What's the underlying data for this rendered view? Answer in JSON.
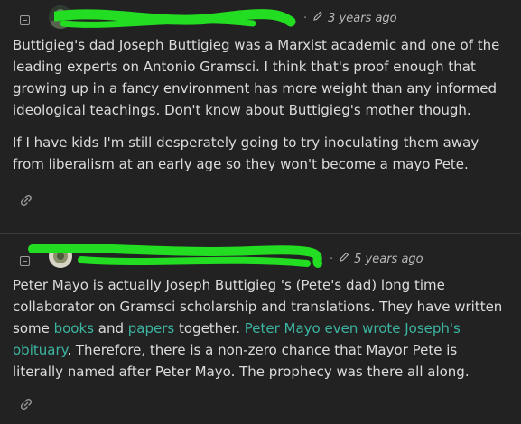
{
  "comments": [
    {
      "time_ago": "3 years ago",
      "paragraphs": [
        "Buttigieg's dad Joseph Buttigieg was a Marxist academic and one of the leading experts on Antonio Gramsci. I think that's proof enough that growing up in a fancy environment has more weight than any informed ideological teachings. Don't know about Buttigieg's mother though.",
        "If I have kids I'm still desperately going to try inoculating them away from liberalism at an early age so they won't become a mayo Pete."
      ]
    },
    {
      "time_ago": "5 years ago",
      "text_parts": {
        "p1": "Peter Mayo is actually Joseph Buttigieg 's (Pete's dad) long time collaborator on Gramsci scholarship and translations. They have written some ",
        "link_books": "books",
        "p2": " and ",
        "link_papers": "papers",
        "p3": " together. ",
        "link_obituary": "Peter Mayo even wrote Joseph's obituary",
        "p4": ". Therefore, there is a non-zero chance that Mayor Pete is literally named after Peter Mayo. The prophecy was there all along."
      }
    }
  ],
  "colors": {
    "background": "#222222",
    "text": "#dcdcdc",
    "link": "#3cb4a0",
    "meta": "#b8b8b8",
    "redaction": "#22dd22"
  },
  "icons": [
    "collapse-icon",
    "avatar",
    "pencil-icon",
    "link-icon"
  ]
}
